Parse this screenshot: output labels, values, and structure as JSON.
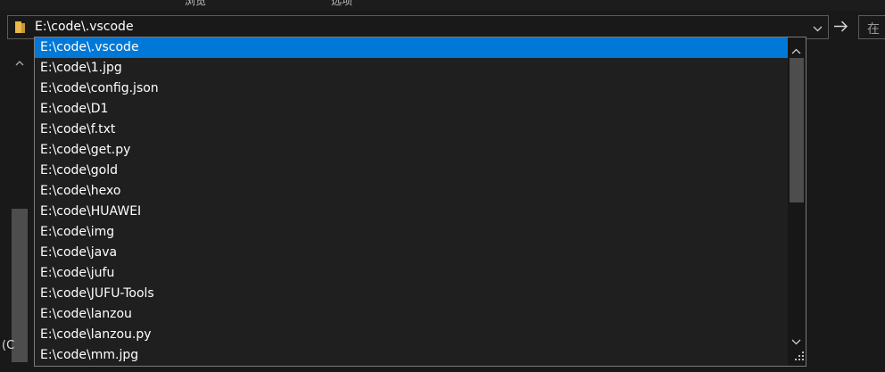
{
  "ribbon": {
    "tabs": [
      "浏览",
      "选项"
    ]
  },
  "address_bar": {
    "path": "E:\\code\\.vscode"
  },
  "search": {
    "placeholder": "在"
  },
  "left_pane": {
    "partial_text": "(C"
  },
  "dropdown": {
    "selected_index": 0,
    "items": [
      "E:\\code\\.vscode",
      "E:\\code\\1.jpg",
      "E:\\code\\config.json",
      "E:\\code\\D1",
      "E:\\code\\f.txt",
      "E:\\code\\get.py",
      "E:\\code\\gold",
      "E:\\code\\hexo",
      "E:\\code\\HUAWEI",
      "E:\\code\\img",
      "E:\\code\\java",
      "E:\\code\\jufu",
      "E:\\code\\JUFU-Tools",
      "E:\\code\\lanzou",
      "E:\\code\\lanzou.py",
      "E:\\code\\mm.jpg"
    ]
  },
  "colors": {
    "background": "#191919",
    "selection": "#0078d7",
    "border": "#7a7a7a",
    "folder": "#e8b84a"
  },
  "icons": {
    "folder": "folder-icon",
    "dropdown": "chevron-down-icon",
    "go": "arrow-right-icon",
    "scroll_up": "chevron-up-icon",
    "scroll_down": "chevron-down-icon",
    "resize": "resize-grip-icon"
  }
}
